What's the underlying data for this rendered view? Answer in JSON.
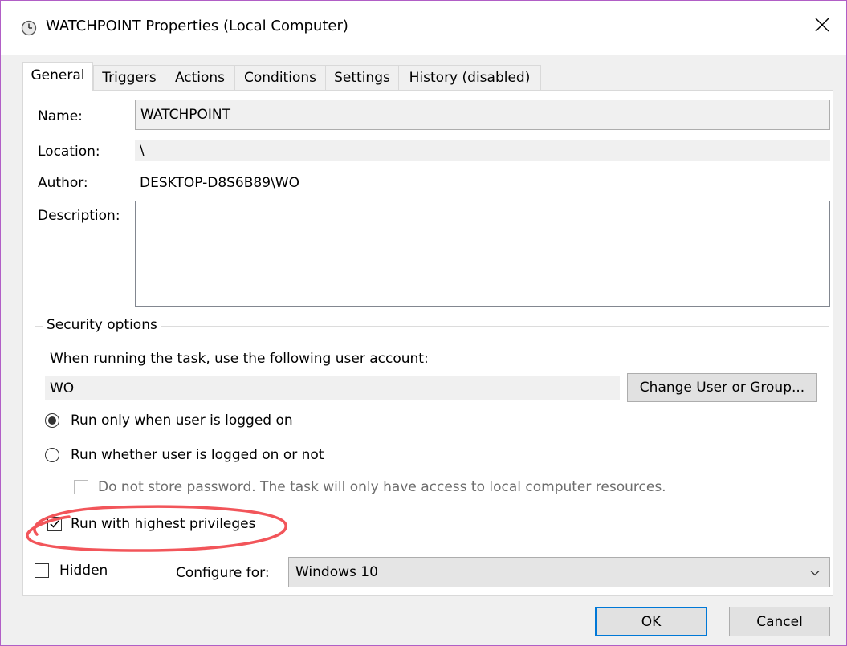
{
  "window": {
    "title": "WATCHPOINT Properties (Local Computer)",
    "title_icon": "clock-icon",
    "close_icon": "close-icon"
  },
  "tabs": [
    {
      "label": "General",
      "active": true
    },
    {
      "label": "Triggers",
      "active": false
    },
    {
      "label": "Actions",
      "active": false
    },
    {
      "label": "Conditions",
      "active": false
    },
    {
      "label": "Settings",
      "active": false
    },
    {
      "label": "History (disabled)",
      "active": false
    }
  ],
  "general": {
    "name_label": "Name:",
    "name_value": "WATCHPOINT",
    "location_label": "Location:",
    "location_value": "\\",
    "author_label": "Author:",
    "author_value": "DESKTOP-D8S6B89\\WO",
    "description_label": "Description:",
    "description_value": ""
  },
  "security": {
    "group_title": "Security options",
    "account_prompt": "When running the task, use the following user account:",
    "account_value": "WO",
    "change_button": "Change User or Group...",
    "radio_logged_on": "Run only when user is logged on",
    "radio_logged_on_selected": true,
    "radio_whether": "Run whether user is logged on or not",
    "radio_whether_selected": false,
    "do_not_store": "Do not store password.  The task will only have access to local computer resources.",
    "do_not_store_checked": false,
    "highest_privileges": "Run with highest privileges",
    "highest_privileges_checked": true
  },
  "footer": {
    "hidden_label": "Hidden",
    "hidden_checked": false,
    "configure_label": "Configure for:",
    "configure_value": "Windows 10",
    "ok_button": "OK",
    "cancel_button": "Cancel"
  },
  "colors": {
    "window_border": "#b15ec6",
    "default_button_border": "#0078d7",
    "annotation_red": "#f2555a"
  }
}
